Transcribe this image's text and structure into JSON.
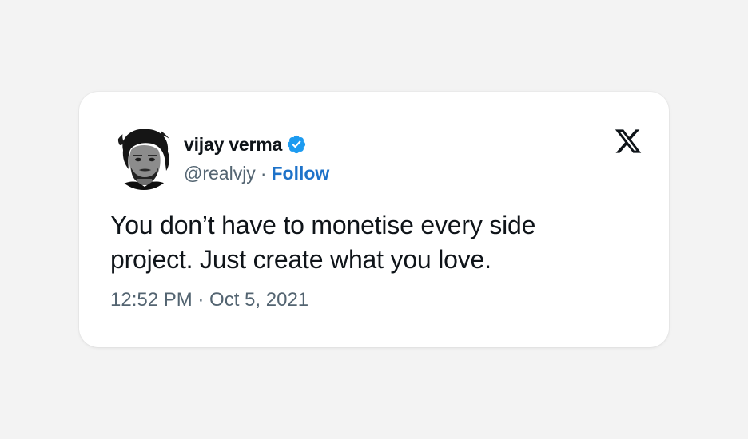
{
  "author": {
    "name": "vijay verma",
    "handle": "@realvjy",
    "separator": "·",
    "follow_label": "Follow",
    "verified_color": "#1d9bf0",
    "avatar_icon": "profile-photo"
  },
  "tweet": {
    "text": "You don’t have to monetise every side project. Just create what you love.",
    "timestamp": "12:52 PM · Oct 5, 2021"
  },
  "platform": {
    "logo_icon": "x-logo-icon"
  },
  "colors": {
    "background": "#f3f3f3",
    "card": "#ffffff",
    "text": "#0f1419",
    "muted": "#536471",
    "link": "#1d72c9"
  }
}
